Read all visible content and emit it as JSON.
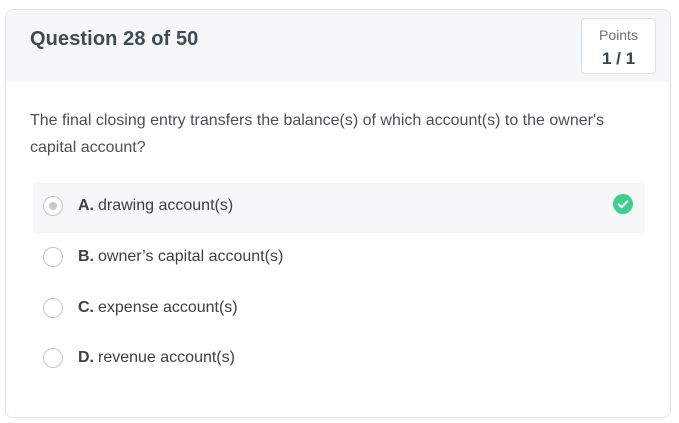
{
  "header": {
    "question_title": "Question 28 of 50",
    "points_label": "Points",
    "points_value": "1 / 1"
  },
  "question": {
    "text": "The final closing entry transfers the balance(s) of which account(s) to the owner's capital account?"
  },
  "options": [
    {
      "letter": "A.",
      "text": "drawing account(s)",
      "selected": true,
      "correct": true
    },
    {
      "letter": "B.",
      "text": "owner’s capital account(s)",
      "selected": false,
      "correct": false
    },
    {
      "letter": "C.",
      "text": "expense account(s)",
      "selected": false,
      "correct": false
    },
    {
      "letter": "D.",
      "text": "revenue account(s)",
      "selected": false,
      "correct": false
    }
  ],
  "colors": {
    "correct_check": "#3ecf8e",
    "header_bg": "#f6f7f8",
    "selected_bg": "#f6f7f8"
  },
  "icons": {
    "correct": "check-circle-icon"
  }
}
